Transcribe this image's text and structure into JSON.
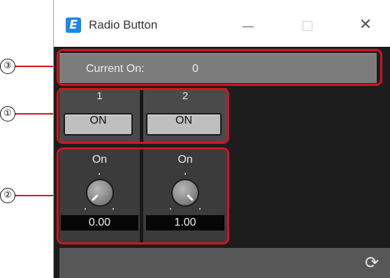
{
  "window": {
    "title": "Radio Button",
    "icon": "app-e-icon",
    "controls": {
      "minimize_icon": "minimize-icon",
      "maximize_icon": "maximize-icon",
      "close_icon": "close-icon",
      "close_glyph": "✕"
    }
  },
  "current_on": {
    "label": "Current On:",
    "value": "0"
  },
  "buttons": [
    {
      "number": "1",
      "label": "ON"
    },
    {
      "number": "2",
      "label": "ON"
    }
  ],
  "knobs": [
    {
      "label": "On",
      "value": "0.00",
      "level": 0.0
    },
    {
      "label": "On",
      "value": "1.00",
      "level": 1.0
    }
  ],
  "footer": {
    "refresh_icon": "refresh-icon",
    "refresh_glyph": "⟳"
  },
  "callouts": [
    {
      "marker": "③"
    },
    {
      "marker": "①"
    },
    {
      "marker": "②"
    }
  ],
  "colors": {
    "callout": "#d4141f",
    "window_bg": "#1d1d1d",
    "app_icon": "#1e88e5"
  }
}
